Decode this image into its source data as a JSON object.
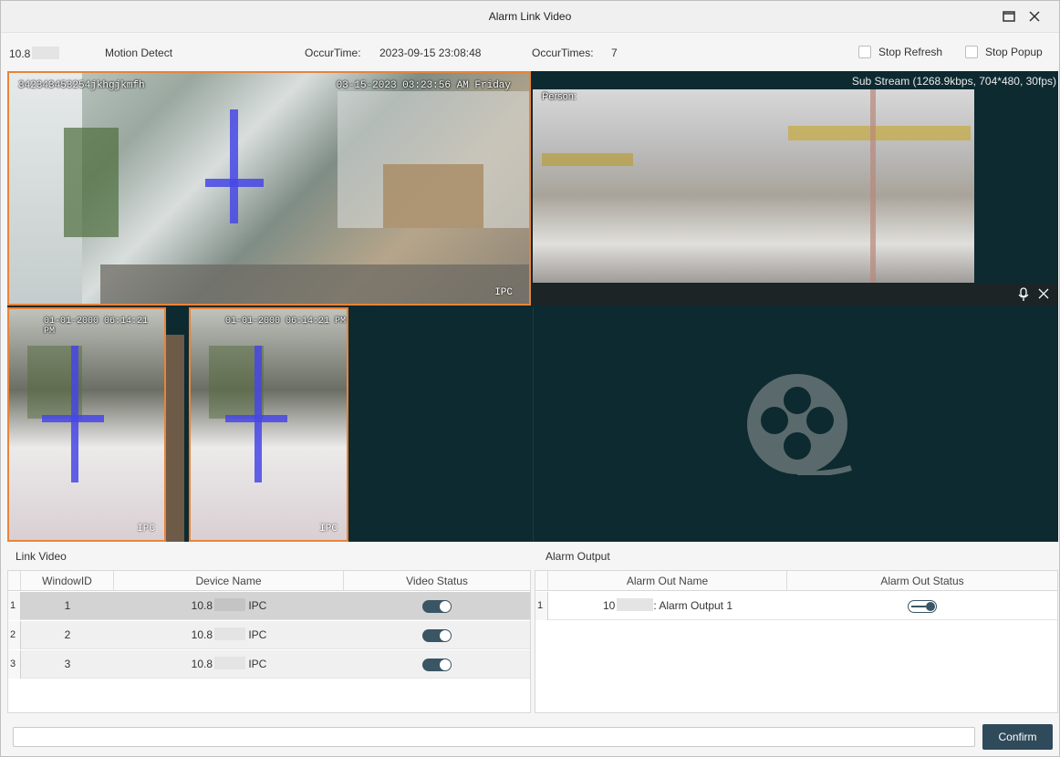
{
  "window": {
    "title": "Alarm Link Video"
  },
  "info": {
    "device_ip": "10.8",
    "event_type": "Motion Detect",
    "occur_time_label": "OccurTime:",
    "occur_time_value": "2023-09-15 23:08:48",
    "occur_times_label": "OccurTimes:",
    "occur_times_value": "7",
    "stop_refresh": "Stop Refresh",
    "stop_popup": "Stop Popup"
  },
  "video": {
    "main_cam": {
      "osd_left": "342343453254jkhgjkmfh",
      "osd_right": "03-15-2023 03:23:56 AM Friday",
      "ipc_tag": "IPC"
    },
    "stream": {
      "info": "Sub Stream (1268.9kbps, 704*480, 30fps)",
      "person_label": "Person:"
    },
    "small_cam_1": {
      "osd": "01-01-2000 06:14:21 PM",
      "ipc_tag": "IPC"
    },
    "small_cam_2": {
      "osd": "01-01-2000 06:14:21 PM",
      "ipc_tag": "IPC"
    }
  },
  "link_video": {
    "title": "Link Video",
    "headers": [
      "WindowID",
      "Device Name",
      "Video Status"
    ],
    "rows": [
      {
        "num": "1",
        "window_id": "1",
        "device_prefix": "10.8",
        "device_suffix": "IPC",
        "status": "on"
      },
      {
        "num": "2",
        "window_id": "2",
        "device_prefix": "10.8",
        "device_suffix": "IPC",
        "status": "on"
      },
      {
        "num": "3",
        "window_id": "3",
        "device_prefix": "10.8",
        "device_suffix": "IPC",
        "status": "on"
      }
    ]
  },
  "alarm_output": {
    "title": "Alarm Output",
    "headers": [
      "Alarm Out Name",
      "Alarm Out Status"
    ],
    "rows": [
      {
        "num": "1",
        "name_prefix": "10",
        "name_suffix": ": Alarm Output 1",
        "status": "off"
      }
    ]
  },
  "footer": {
    "confirm": "Confirm"
  },
  "colors": {
    "accent": "#2f4a5a",
    "video_bg": "#0d2a30",
    "selected_border": "#e8843a"
  }
}
